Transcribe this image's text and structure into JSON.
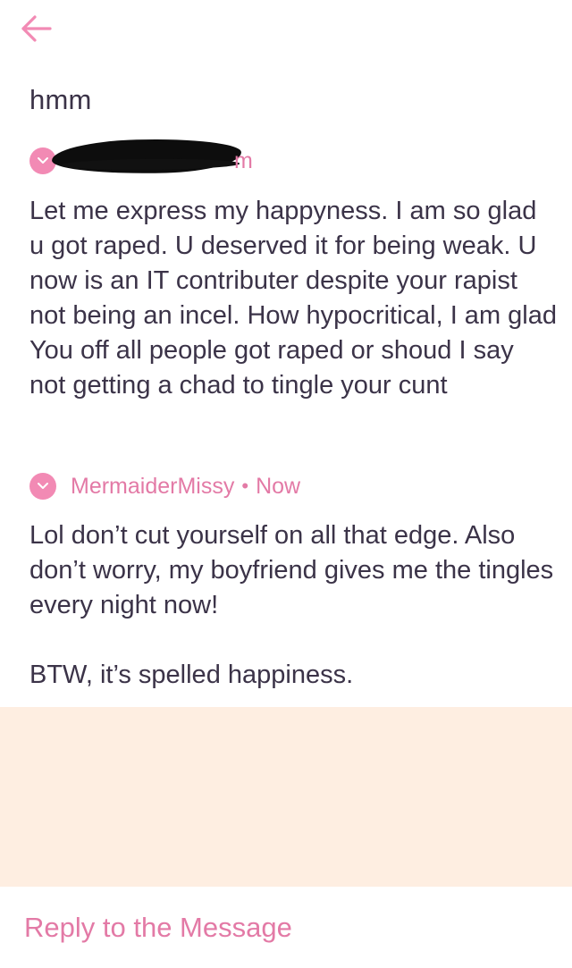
{
  "header": {
    "back_icon": "arrow-left-icon",
    "title": "hmm",
    "accent_color": "#f28ab4"
  },
  "messages": [
    {
      "author": "",
      "author_redacted": true,
      "time_fragment": "m",
      "avatar_icon": "chevron-down-icon",
      "body": "Let me express my happyness. I am so glad u got raped. U deserved it for being weak. U now is an IT contributer despite your rapist not being an incel. How hypocritical, I am glad You off all people got raped or shoud I say not getting a chad to tingle your cunt"
    },
    {
      "author": "MermaiderMissy",
      "separator": "•",
      "time": "Now",
      "avatar_icon": "chevron-down-icon",
      "body": "Lol don’t cut yourself on all that edge. Also don’t worry, my boyfriend gives me the tingles every night now!\n\nBTW, it’s spelled happiness."
    }
  ],
  "footer": {
    "reply_label": "Reply to the Message",
    "panel_color": "#feeee1"
  }
}
